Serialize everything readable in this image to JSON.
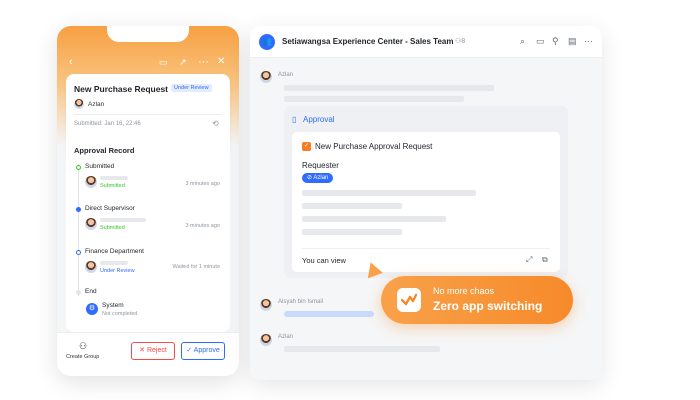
{
  "phone": {
    "nav_icons": [
      "chevron-left",
      "chat-bubble",
      "share",
      "more",
      "close"
    ],
    "request": {
      "title": "New Purchase Request",
      "status_badge": "Under Review",
      "requester": "Azlan",
      "submitted": "Submitted: Jan 16, 22:46"
    },
    "record": {
      "title": "Approval Record",
      "steps": [
        {
          "label": "Submitted",
          "status": "Submitted",
          "time": "3 minutes ago"
        },
        {
          "label": "Direct Supervisor",
          "status": "Submitted",
          "time": "3 minutes ago"
        },
        {
          "label": "Finance Department",
          "status": "Under Review",
          "time": "Waited for 1 minute"
        },
        {
          "label": "End",
          "person": "System",
          "status": "Not completed"
        }
      ]
    },
    "bottom": {
      "create_group": "Create Group",
      "reject": "Reject",
      "approve": "Approve"
    }
  },
  "chat": {
    "title": "Setiawangsa Experience Center - Sales Team",
    "member_count": "8",
    "messages": [
      {
        "sender": "Azlan"
      },
      {
        "sender": "Aisyah bin Ismail"
      },
      {
        "sender": "Azlan"
      }
    ],
    "approval_card": {
      "header": "Approval",
      "title": "New Purchase Approval Request",
      "requester_label": "Requester",
      "requester_chip": "Azlan",
      "footer": "You can view"
    }
  },
  "callout": {
    "line1": "No more chaos",
    "line2": "Zero app switching"
  },
  "colors": {
    "accent_orange": "#f68a2a",
    "accent_blue": "#2f6bff",
    "reject_red": "#f54a45",
    "success_green": "#34c724"
  }
}
